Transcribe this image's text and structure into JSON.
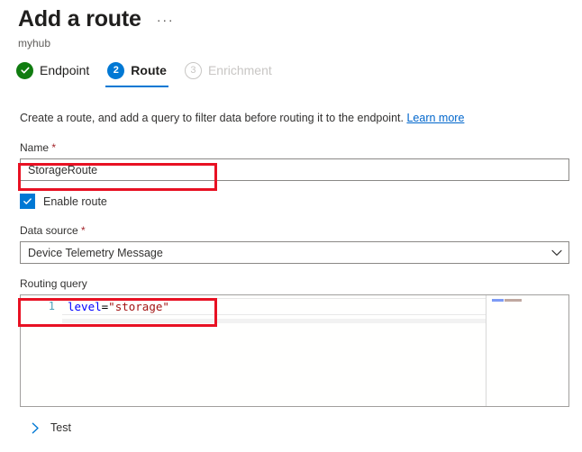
{
  "header": {
    "title": "Add a route",
    "more_menu": "···",
    "subtitle": "myhub"
  },
  "wizard": {
    "steps": [
      {
        "number": "1",
        "label": "Endpoint",
        "state": "done",
        "badge_icon": "check-icon"
      },
      {
        "number": "2",
        "label": "Route",
        "state": "active"
      },
      {
        "number": "3",
        "label": "Enrichment",
        "state": "todo"
      }
    ]
  },
  "main": {
    "intro": "Create a route, and add a query to filter data before routing it to the endpoint.",
    "learn_more": "Learn more",
    "name_field": {
      "label": "Name",
      "required_marker": "*",
      "value": "StorageRoute",
      "placeholder": ""
    },
    "enable_route": {
      "label": "Enable route",
      "checked": "true"
    },
    "data_source": {
      "label": "Data source",
      "required_marker": "*",
      "selected": "Device Telemetry Message",
      "chevron_icon": "chevron-down-icon"
    },
    "routing_query": {
      "label": "Routing query",
      "line_number": "1",
      "tokens": {
        "key": "level",
        "operator": "=",
        "string": "\"storage\""
      },
      "full_text": "level=\"storage\""
    },
    "test_section": {
      "label": "Test",
      "chevron_icon": "chevron-right-icon",
      "expanded": "false"
    }
  },
  "annotations": [
    {
      "name": "name-field-highlight",
      "color": "#E81123"
    },
    {
      "name": "routing-query-highlight",
      "color": "#E81123"
    }
  ],
  "colors": {
    "accent": "#0078D4",
    "success": "#107C10",
    "required": "#A4262C",
    "link": "#0066CC",
    "annotation": "#E81123",
    "code_keyword": "#0000FF",
    "code_string": "#A31515",
    "line_number": "#2B91AF"
  }
}
